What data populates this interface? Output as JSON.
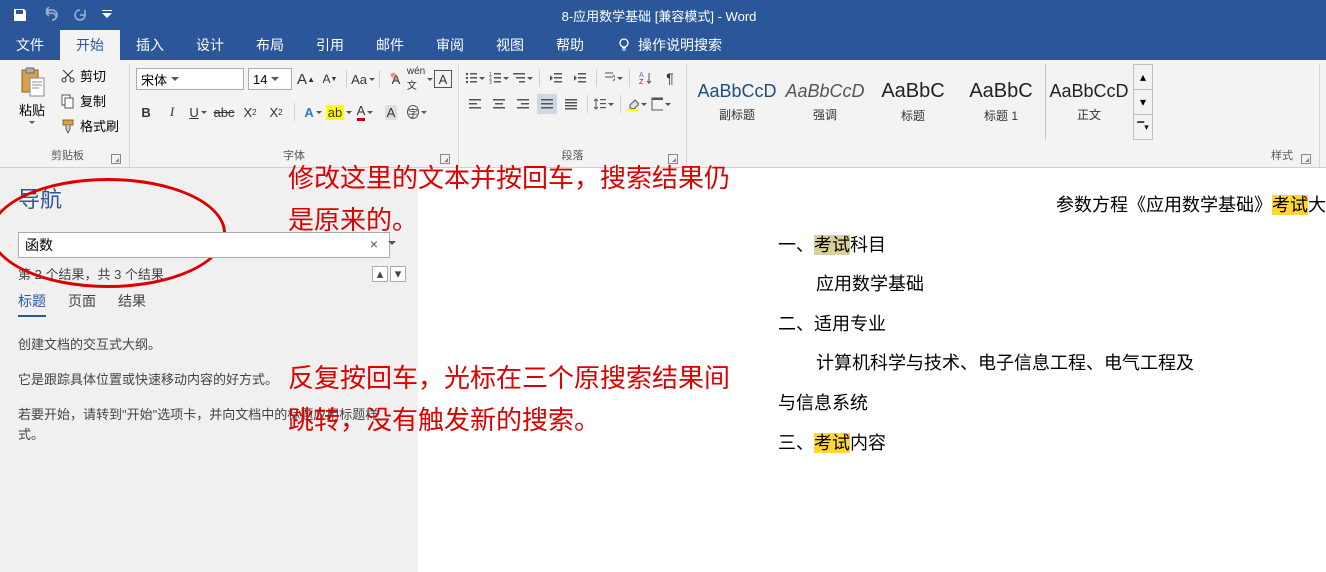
{
  "titlebar": {
    "document_title": "8-应用数学基础 [兼容模式] - Word"
  },
  "ribbon_tabs": {
    "file": "文件",
    "home": "开始",
    "insert": "插入",
    "design": "设计",
    "layout": "布局",
    "references": "引用",
    "mailings": "邮件",
    "review": "审阅",
    "view": "视图",
    "help": "帮助",
    "tellme": "操作说明搜索"
  },
  "clipboard": {
    "paste": "粘贴",
    "cut": "剪切",
    "copy": "复制",
    "format_painter": "格式刷",
    "group": "剪贴板"
  },
  "font": {
    "name": "宋体",
    "size": "14",
    "group": "字体"
  },
  "paragraph": {
    "group": "段落"
  },
  "styles_group": {
    "group": "样式",
    "items": [
      {
        "sample": "AaBbCcD",
        "name": "副标题",
        "style": "color:#1f4e79;"
      },
      {
        "sample": "AaBbCcD",
        "name": "强调",
        "style": "font-style:italic;color:#555;"
      },
      {
        "sample": "AaBbC",
        "name": "标题",
        "style": "color:#222;font-size:20px;"
      },
      {
        "sample": "AaBbC",
        "name": "标题 1",
        "style": "color:#222;font-size:20px;"
      },
      {
        "sample": "AaBbCcD",
        "name": "正文",
        "style": "color:#222;"
      }
    ]
  },
  "nav": {
    "title": "导航",
    "search_value": "函数",
    "result_count": "第 2 个结果，共 3 个结果",
    "tabs": {
      "headings": "标题",
      "pages": "页面",
      "results": "结果"
    },
    "help1": "创建文档的交互式大纲。",
    "help2": "它是跟踪具体位置或快速移动内容的好方式。",
    "help3": "若要开始，请转到\"开始\"选项卡，并向文档中的标题应用标题样式。"
  },
  "annotations": {
    "a1_l1": "修改这里的文本并按回车，搜索结果仍",
    "a1_l2": "是原来的。",
    "a2_l1": "反复按回车，光标在三个原搜索结果间",
    "a2_l2": "跳转，没有触发新的搜索。"
  },
  "document": {
    "title_prefix": "参数方程《应用数学基础》",
    "title_hl": "考试",
    "title_suffix": "大",
    "s1_num": "一、",
    "s1_hl": "考试",
    "s1_suffix": "科目",
    "s1_body": "应用数学基础",
    "s2_num": "二、",
    "s2_hl_strike": "适用专业",
    "s2_body": "计算机科学与技术、电子信息工程、电气工程及",
    "s2_body2": "与信息系统",
    "s3_num": "三、",
    "s3_hl": "考试",
    "s3_suffix": "内容"
  }
}
